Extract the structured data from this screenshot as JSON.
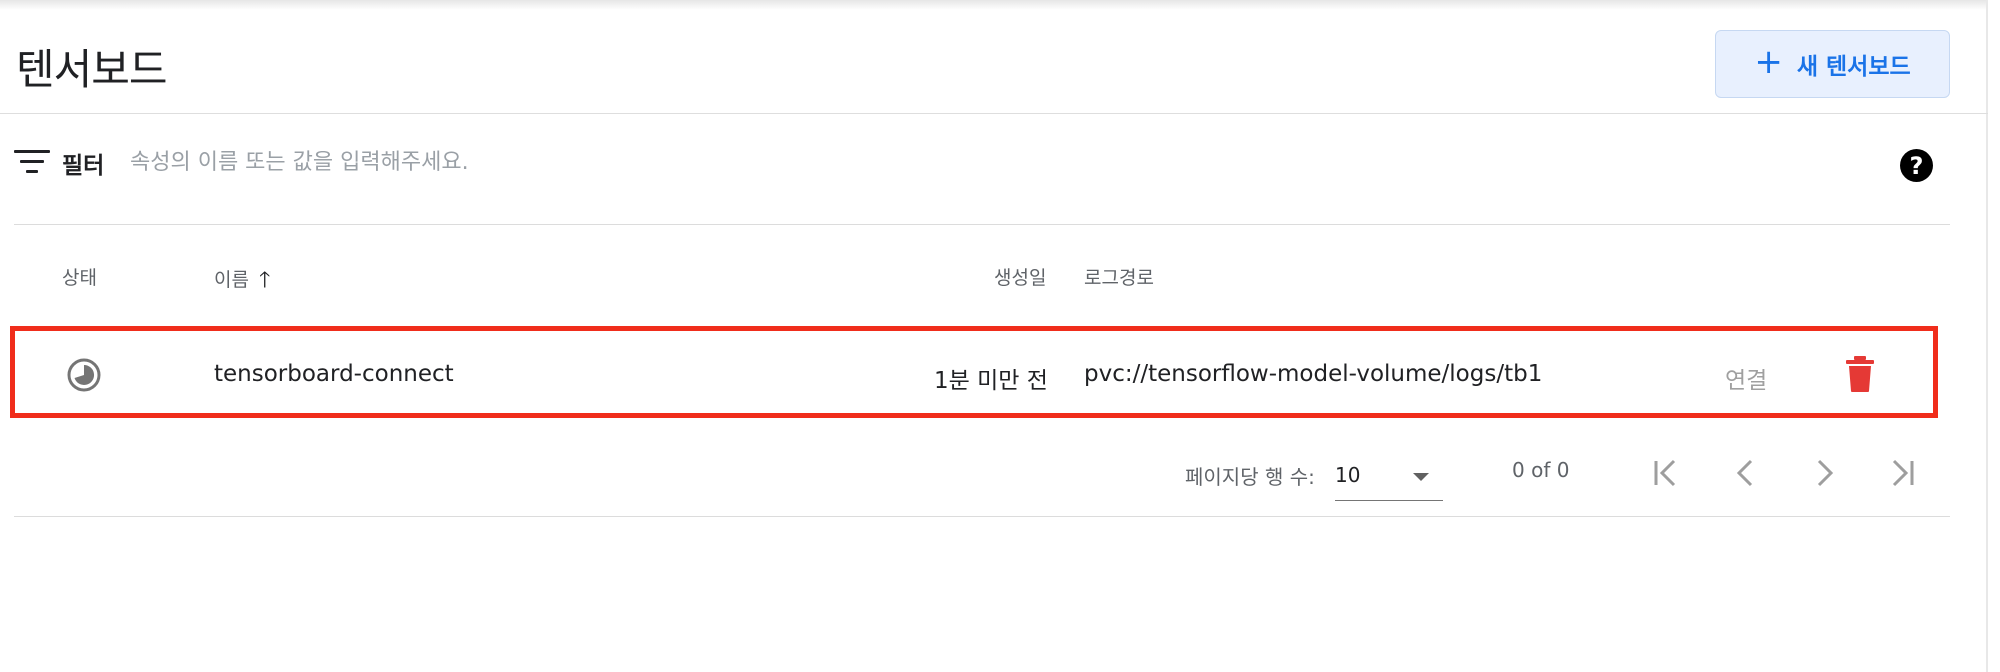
{
  "page": {
    "title": "텐서보드"
  },
  "toolbar": {
    "new_button_label": "새 텐서보드",
    "new_button_icon": "plus-icon"
  },
  "filter": {
    "label": "필터",
    "placeholder": "속성의 이름 또는 값을 입력해주세요.",
    "value": ""
  },
  "table": {
    "columns": {
      "status": "상태",
      "name": "이름",
      "created": "생성일",
      "log_path": "로그경로"
    },
    "sort": {
      "column": "이름",
      "direction": "ascending"
    },
    "rows": [
      {
        "status_icon": "pending-clock-icon",
        "name": "tensorboard-connect",
        "created": "1분 미만 전",
        "log_path": "pvc://tensorflow-model-volume/logs/tb1",
        "connect_label": "연결",
        "delete_icon": "trash-icon"
      }
    ]
  },
  "pagination": {
    "rows_per_page_label": "페이지당 행 수:",
    "rows_per_page_value": "10",
    "range_label": "0 of 0"
  },
  "colors": {
    "accent": "#1a73e8",
    "accent_bg": "#e8f0fe",
    "danger": "#e53935",
    "highlight_border": "#f02d1b"
  }
}
